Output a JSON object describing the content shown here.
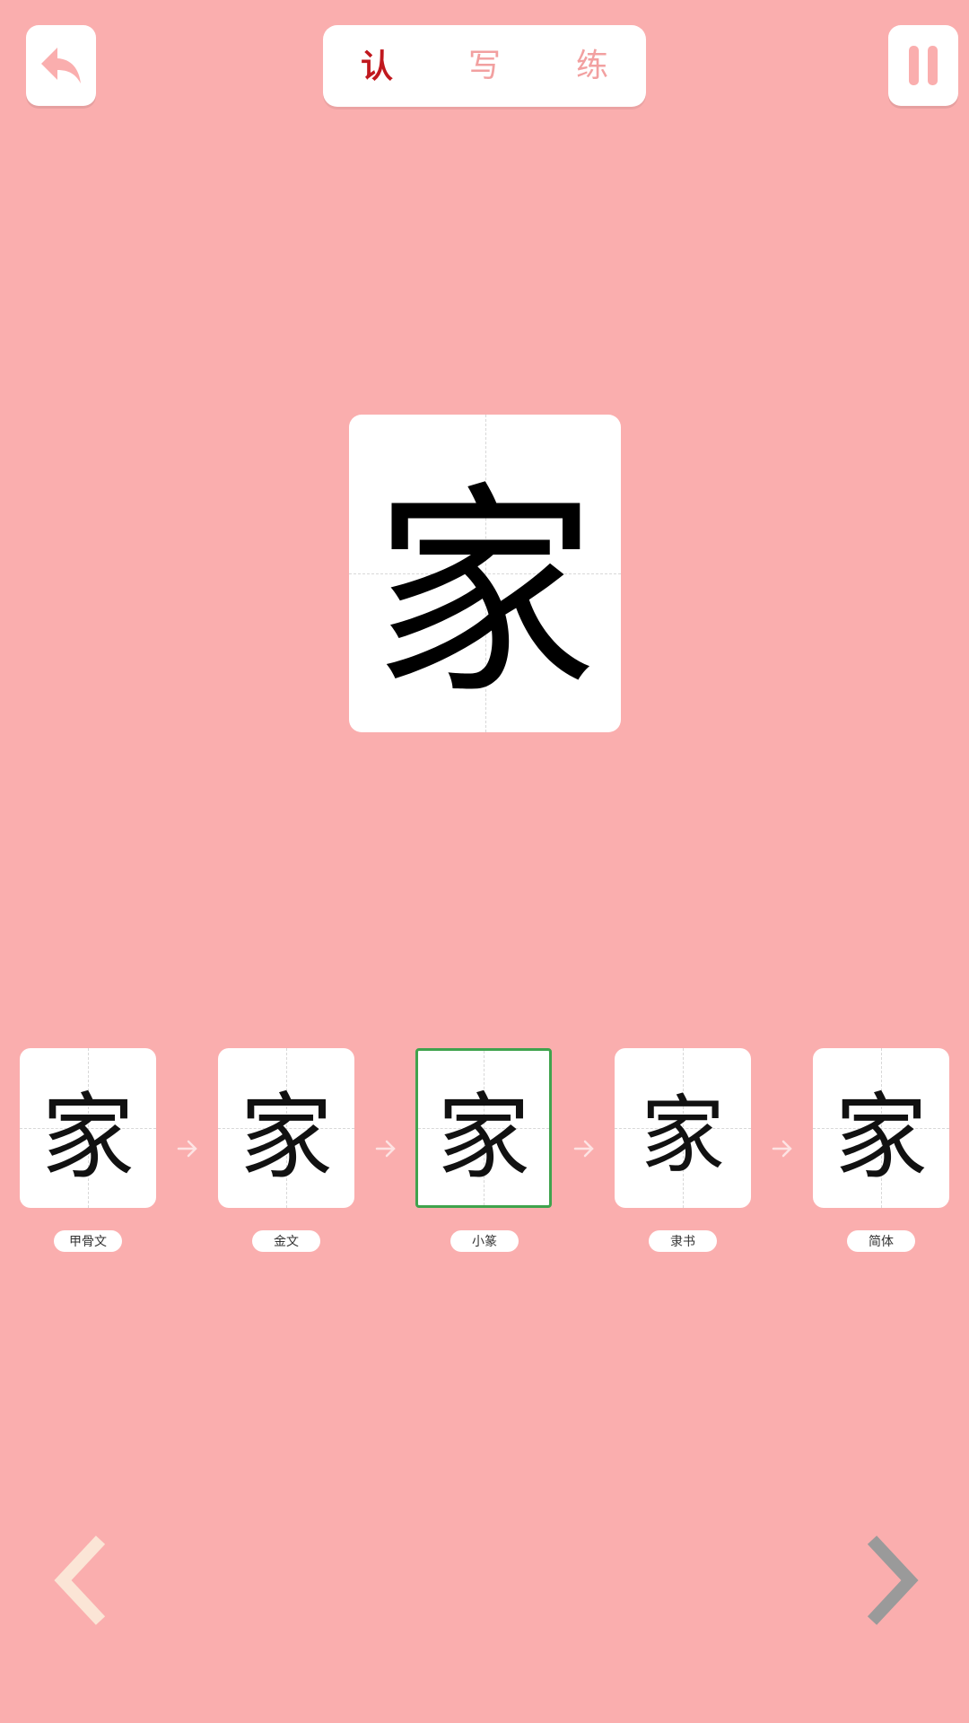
{
  "tabs": [
    {
      "label": "认",
      "active": true
    },
    {
      "label": "写",
      "active": false
    },
    {
      "label": "练",
      "active": false
    }
  ],
  "main_character": "家",
  "evolution": [
    {
      "glyph": "家",
      "label": "甲骨文"
    },
    {
      "glyph": "家",
      "label": "金文"
    },
    {
      "glyph": "家",
      "label": "小篆",
      "selected": true
    },
    {
      "glyph": "家",
      "label": "隶书"
    },
    {
      "glyph": "家",
      "label": "简体"
    }
  ],
  "icons": {
    "back": "back-arrow-icon",
    "pause": "pause-icon",
    "prev": "chevron-left-icon",
    "next": "chevron-right-icon",
    "step": "arrow-right-icon"
  },
  "colors": {
    "background": "#faaeae",
    "active_tab": "#c0181e",
    "inactive_tab": "#f2a0a0",
    "selected_border": "#3fa34d",
    "prev_arrow": "#fbe5d6",
    "next_arrow": "#9a9a9a"
  }
}
